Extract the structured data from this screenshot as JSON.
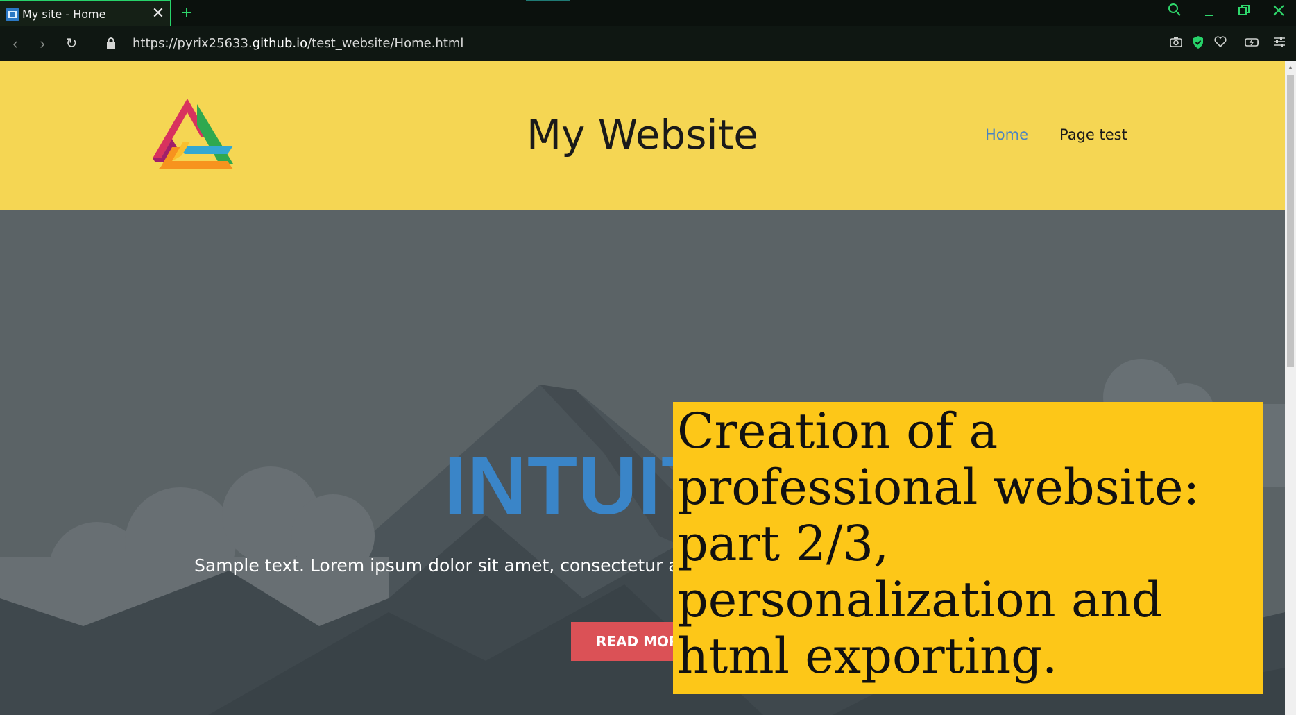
{
  "browser": {
    "tab_title": "My site - Home",
    "url_prefix": "https://pyrix25633.",
    "url_host": "github.io",
    "url_path": "/test_website/Home.html"
  },
  "site": {
    "title": "My Website",
    "nav": [
      {
        "label": "Home",
        "color": "#4a83c1",
        "active": true
      },
      {
        "label": "Page test",
        "color": "#1a1a1a",
        "active": false
      }
    ],
    "colors": {
      "header_bg": "#f5d653",
      "hero_bg": "#5b6366",
      "heading": "#3a85c8",
      "button": "#db5156"
    }
  },
  "hero": {
    "heading": "INTUIT",
    "text": "Sample text. Lorem ipsum dolor sit amet, consectetur adipis",
    "button_label": "READ MORE"
  },
  "overlay": {
    "caption": "Creation of a professional website: part 2/3, personalization and html exporting.",
    "color": "#fdc718"
  }
}
